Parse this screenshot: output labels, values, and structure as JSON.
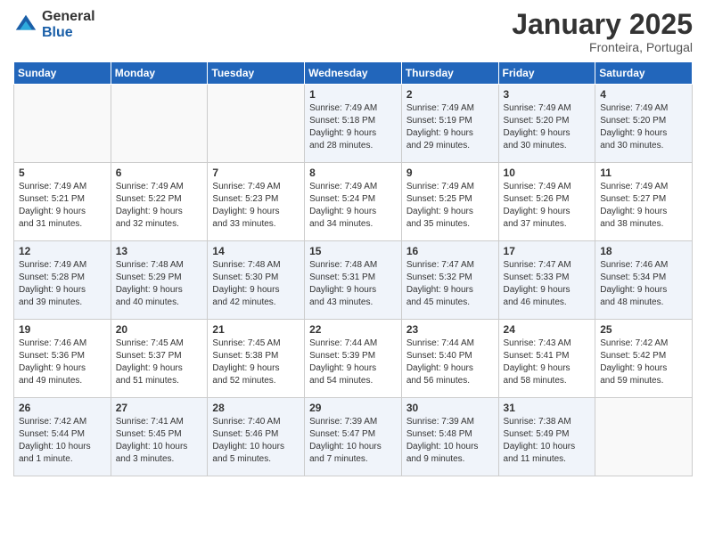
{
  "logo": {
    "general": "General",
    "blue": "Blue"
  },
  "header": {
    "title": "January 2025",
    "subtitle": "Fronteira, Portugal"
  },
  "days_of_week": [
    "Sunday",
    "Monday",
    "Tuesday",
    "Wednesday",
    "Thursday",
    "Friday",
    "Saturday"
  ],
  "weeks": [
    [
      {
        "day": "",
        "info": ""
      },
      {
        "day": "",
        "info": ""
      },
      {
        "day": "",
        "info": ""
      },
      {
        "day": "1",
        "info": "Sunrise: 7:49 AM\nSunset: 5:18 PM\nDaylight: 9 hours\nand 28 minutes."
      },
      {
        "day": "2",
        "info": "Sunrise: 7:49 AM\nSunset: 5:19 PM\nDaylight: 9 hours\nand 29 minutes."
      },
      {
        "day": "3",
        "info": "Sunrise: 7:49 AM\nSunset: 5:20 PM\nDaylight: 9 hours\nand 30 minutes."
      },
      {
        "day": "4",
        "info": "Sunrise: 7:49 AM\nSunset: 5:20 PM\nDaylight: 9 hours\nand 30 minutes."
      }
    ],
    [
      {
        "day": "5",
        "info": "Sunrise: 7:49 AM\nSunset: 5:21 PM\nDaylight: 9 hours\nand 31 minutes."
      },
      {
        "day": "6",
        "info": "Sunrise: 7:49 AM\nSunset: 5:22 PM\nDaylight: 9 hours\nand 32 minutes."
      },
      {
        "day": "7",
        "info": "Sunrise: 7:49 AM\nSunset: 5:23 PM\nDaylight: 9 hours\nand 33 minutes."
      },
      {
        "day": "8",
        "info": "Sunrise: 7:49 AM\nSunset: 5:24 PM\nDaylight: 9 hours\nand 34 minutes."
      },
      {
        "day": "9",
        "info": "Sunrise: 7:49 AM\nSunset: 5:25 PM\nDaylight: 9 hours\nand 35 minutes."
      },
      {
        "day": "10",
        "info": "Sunrise: 7:49 AM\nSunset: 5:26 PM\nDaylight: 9 hours\nand 37 minutes."
      },
      {
        "day": "11",
        "info": "Sunrise: 7:49 AM\nSunset: 5:27 PM\nDaylight: 9 hours\nand 38 minutes."
      }
    ],
    [
      {
        "day": "12",
        "info": "Sunrise: 7:49 AM\nSunset: 5:28 PM\nDaylight: 9 hours\nand 39 minutes."
      },
      {
        "day": "13",
        "info": "Sunrise: 7:48 AM\nSunset: 5:29 PM\nDaylight: 9 hours\nand 40 minutes."
      },
      {
        "day": "14",
        "info": "Sunrise: 7:48 AM\nSunset: 5:30 PM\nDaylight: 9 hours\nand 42 minutes."
      },
      {
        "day": "15",
        "info": "Sunrise: 7:48 AM\nSunset: 5:31 PM\nDaylight: 9 hours\nand 43 minutes."
      },
      {
        "day": "16",
        "info": "Sunrise: 7:47 AM\nSunset: 5:32 PM\nDaylight: 9 hours\nand 45 minutes."
      },
      {
        "day": "17",
        "info": "Sunrise: 7:47 AM\nSunset: 5:33 PM\nDaylight: 9 hours\nand 46 minutes."
      },
      {
        "day": "18",
        "info": "Sunrise: 7:46 AM\nSunset: 5:34 PM\nDaylight: 9 hours\nand 48 minutes."
      }
    ],
    [
      {
        "day": "19",
        "info": "Sunrise: 7:46 AM\nSunset: 5:36 PM\nDaylight: 9 hours\nand 49 minutes."
      },
      {
        "day": "20",
        "info": "Sunrise: 7:45 AM\nSunset: 5:37 PM\nDaylight: 9 hours\nand 51 minutes."
      },
      {
        "day": "21",
        "info": "Sunrise: 7:45 AM\nSunset: 5:38 PM\nDaylight: 9 hours\nand 52 minutes."
      },
      {
        "day": "22",
        "info": "Sunrise: 7:44 AM\nSunset: 5:39 PM\nDaylight: 9 hours\nand 54 minutes."
      },
      {
        "day": "23",
        "info": "Sunrise: 7:44 AM\nSunset: 5:40 PM\nDaylight: 9 hours\nand 56 minutes."
      },
      {
        "day": "24",
        "info": "Sunrise: 7:43 AM\nSunset: 5:41 PM\nDaylight: 9 hours\nand 58 minutes."
      },
      {
        "day": "25",
        "info": "Sunrise: 7:42 AM\nSunset: 5:42 PM\nDaylight: 9 hours\nand 59 minutes."
      }
    ],
    [
      {
        "day": "26",
        "info": "Sunrise: 7:42 AM\nSunset: 5:44 PM\nDaylight: 10 hours\nand 1 minute."
      },
      {
        "day": "27",
        "info": "Sunrise: 7:41 AM\nSunset: 5:45 PM\nDaylight: 10 hours\nand 3 minutes."
      },
      {
        "day": "28",
        "info": "Sunrise: 7:40 AM\nSunset: 5:46 PM\nDaylight: 10 hours\nand 5 minutes."
      },
      {
        "day": "29",
        "info": "Sunrise: 7:39 AM\nSunset: 5:47 PM\nDaylight: 10 hours\nand 7 minutes."
      },
      {
        "day": "30",
        "info": "Sunrise: 7:39 AM\nSunset: 5:48 PM\nDaylight: 10 hours\nand 9 minutes."
      },
      {
        "day": "31",
        "info": "Sunrise: 7:38 AM\nSunset: 5:49 PM\nDaylight: 10 hours\nand 11 minutes."
      },
      {
        "day": "",
        "info": ""
      }
    ]
  ]
}
